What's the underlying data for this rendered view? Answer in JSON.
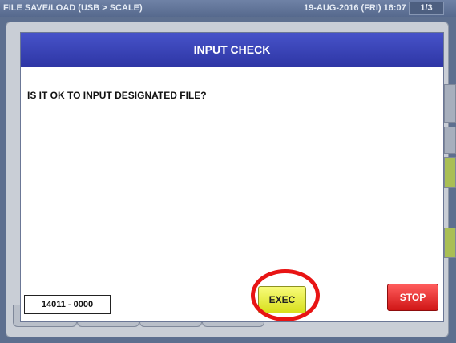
{
  "screen": {
    "title": "FILE SAVE/LOAD (USB > SCALE)",
    "datetime": "19-AUG-2016 (FRI)  16:07",
    "page_indicator": "1/3"
  },
  "dialog": {
    "title": "INPUT CHECK",
    "message": "IS IT OK TO INPUT DESIGNATED FILE?",
    "file_range": "14011 - 0000",
    "exec_label": "EXEC",
    "stop_label": "STOP"
  },
  "colors": {
    "header": "#3a43b8",
    "exec": "#e6ec2e",
    "stop": "#e52323",
    "highlight": "#e81414"
  }
}
